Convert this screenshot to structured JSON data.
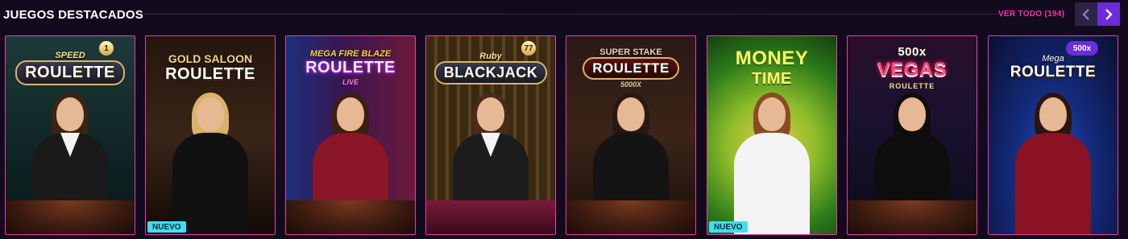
{
  "header": {
    "title": "JUEGOS DESTACADOS",
    "see_all": "VER TODO (194)",
    "prev_icon": "chevron-left-icon",
    "next_icon": "chevron-right-icon"
  },
  "colors": {
    "accent": "#e63fa8",
    "see_all": "#ff2fa8",
    "nav_active": "#6d2bd9",
    "nav_inactive": "#2c2444",
    "new_badge": "#3ee0f0",
    "background": "#120b1e"
  },
  "cards": [
    {
      "small": "SPEED",
      "big": "ROULETTE",
      "sub": "",
      "badge": "",
      "number": "1"
    },
    {
      "small": "GOLD SALOON",
      "big": "ROULETTE",
      "sub": "",
      "badge": "NUEVO",
      "number": ""
    },
    {
      "small": "MEGA FIRE BLAZE",
      "big": "ROULETTE",
      "sub": "LIVE",
      "badge": "",
      "number": ""
    },
    {
      "small": "Ruby",
      "big": "BLACKJACK",
      "sub": "",
      "badge": "",
      "number": "77"
    },
    {
      "small": "SUPER STAKE",
      "big": "ROULETTE",
      "sub": "5000X",
      "badge": "",
      "number": ""
    },
    {
      "small": "MONEY",
      "big": "TIME",
      "sub": "",
      "badge": "NUEVO",
      "number": ""
    },
    {
      "small": "500x",
      "big": "VEGAS",
      "sub": "ROULETTE",
      "badge": "",
      "number": ""
    },
    {
      "small": "Mega",
      "big": "ROULETTE",
      "sub": "",
      "badge": "",
      "number": "500x"
    }
  ]
}
